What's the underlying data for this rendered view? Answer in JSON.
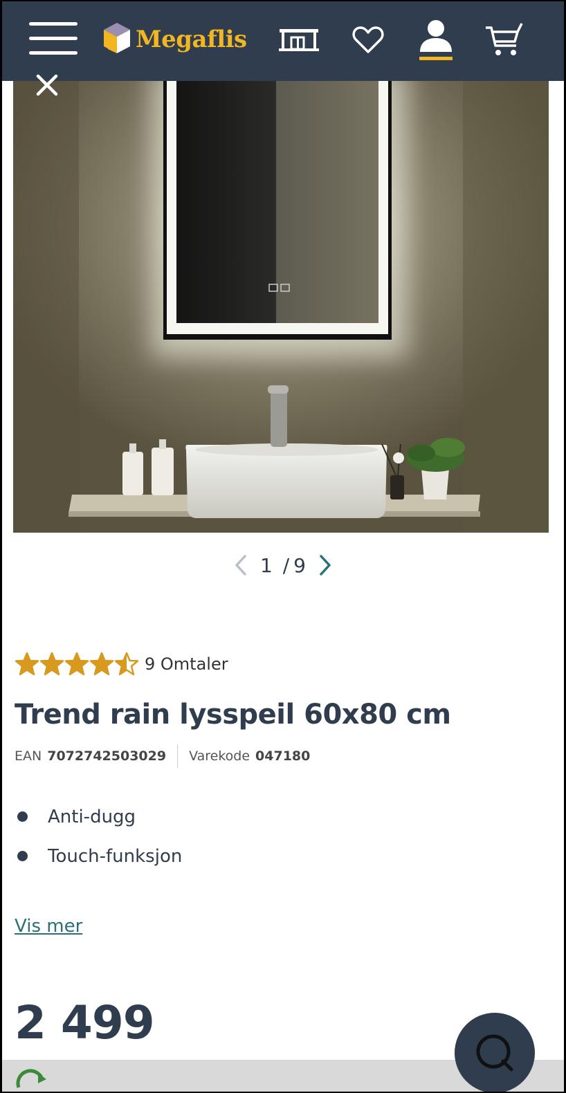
{
  "header": {
    "logo_text": "Megaflis",
    "icons": [
      "menu-icon",
      "store-icon",
      "heart-icon",
      "user-icon",
      "cart-icon"
    ]
  },
  "gallery": {
    "current": "1",
    "separator": "/",
    "total": "9"
  },
  "product": {
    "rating_value": 4.5,
    "rating_max": 5,
    "reviews_label": "9 Omtaler",
    "title": "Trend rain lysspeil 60x80 cm",
    "ean_label": "EAN",
    "ean_value": "7072742503029",
    "varekode_label": "Varekode",
    "varekode_value": "047180",
    "features": [
      "Anti-dugg",
      "Touch-funksjon"
    ],
    "show_more": "Vis mer",
    "price": "2 499"
  },
  "colors": {
    "navy": "#2f3d4e",
    "gold": "#f2b622",
    "star": "#d79a1e",
    "link": "#2b6f78"
  }
}
